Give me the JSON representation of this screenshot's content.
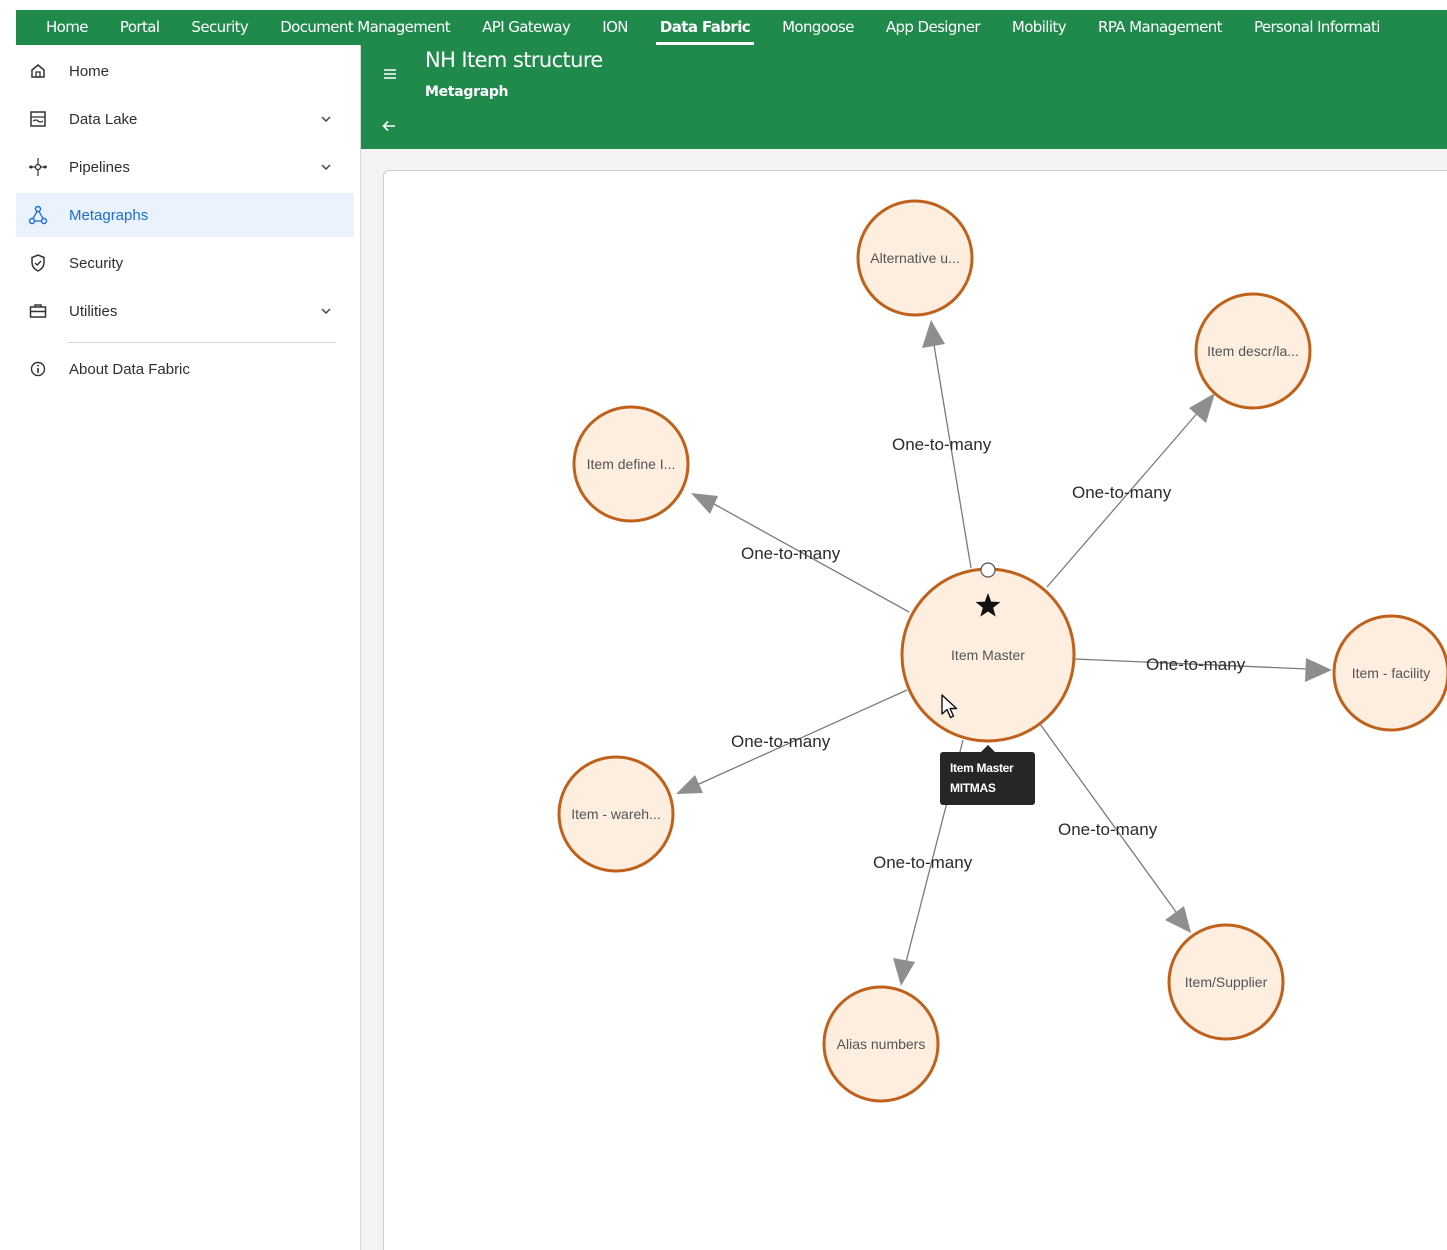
{
  "topnav": {
    "tabs": [
      {
        "label": "Home"
      },
      {
        "label": "Portal"
      },
      {
        "label": "Security"
      },
      {
        "label": "Document Management"
      },
      {
        "label": "API Gateway"
      },
      {
        "label": "ION"
      },
      {
        "label": "Data Fabric",
        "active": true
      },
      {
        "label": "Mongoose"
      },
      {
        "label": "App Designer"
      },
      {
        "label": "Mobility"
      },
      {
        "label": "RPA Management"
      },
      {
        "label": "Personal Informati"
      }
    ]
  },
  "sidebar": {
    "items": [
      {
        "label": "Home",
        "icon": "home-icon"
      },
      {
        "label": "Data Lake",
        "icon": "data-lake-icon",
        "expandable": true
      },
      {
        "label": "Pipelines",
        "icon": "pipelines-icon",
        "expandable": true
      },
      {
        "label": "Metagraphs",
        "icon": "metagraphs-icon",
        "active": true
      },
      {
        "label": "Security",
        "icon": "shield-icon"
      },
      {
        "label": "Utilities",
        "icon": "briefcase-icon",
        "expandable": true
      },
      {
        "label": "About Data Fabric",
        "icon": "info-icon"
      }
    ]
  },
  "header": {
    "title": "NH Item structure",
    "subtitle": "Metagraph"
  },
  "graph": {
    "center": {
      "label": "Item Master",
      "marker": "star"
    },
    "nodes": [
      {
        "label": "Alternative u..."
      },
      {
        "label": "Item descr/la..."
      },
      {
        "label": "Item define I..."
      },
      {
        "label": "Item - facility"
      },
      {
        "label": "Item - wareh..."
      },
      {
        "label": "Alias numbers"
      },
      {
        "label": "Item/Supplier"
      }
    ],
    "edge_labels": [
      "One-to-many",
      "One-to-many",
      "One-to-many",
      "One-to-many",
      "One-to-many",
      "One-to-many",
      "One-to-many"
    ]
  },
  "tooltip": {
    "line1": "Item Master",
    "line2": "MITMAS"
  },
  "colors": {
    "brand_green": "#1f8a4c",
    "node_fill": "#fdeee0",
    "node_stroke": "#c0611b",
    "edge": "#7a7a7a",
    "arrow": "#8e8e8e",
    "active_bg": "#eaf2fd",
    "active_text": "#1b6ed6"
  }
}
